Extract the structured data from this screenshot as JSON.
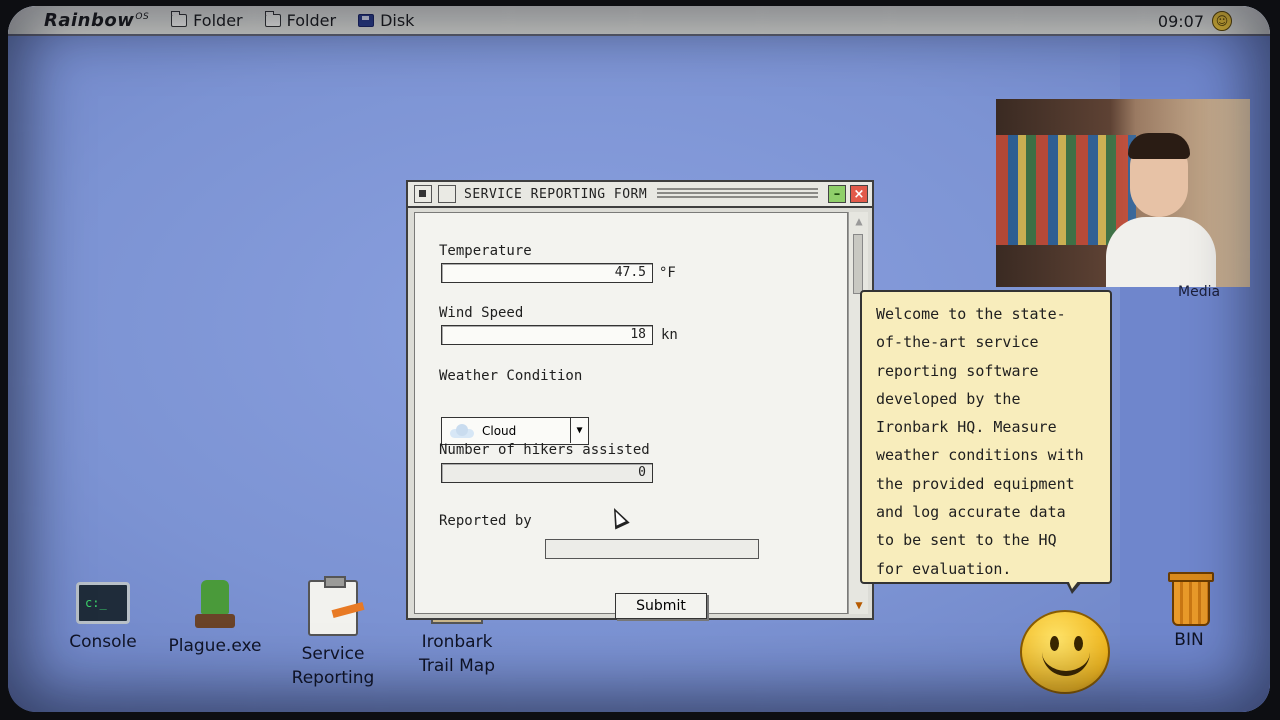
{
  "menubar": {
    "logo": "Rainbow",
    "logo_sup": "OS",
    "items": [
      {
        "label": "Folder",
        "icon": "folder-icon"
      },
      {
        "label": "Folder",
        "icon": "folder-icon"
      },
      {
        "label": "Disk",
        "icon": "disk-icon"
      }
    ],
    "clock": "09:07"
  },
  "window": {
    "title": "SERVICE REPORTING FORM",
    "temperature": {
      "label": "Temperature",
      "value": "47.5",
      "unit": "°F"
    },
    "wind_speed": {
      "label": "Wind Speed",
      "value": "18",
      "unit": "kn"
    },
    "weather": {
      "label": "Weather Condition",
      "value": "Cloud"
    },
    "hikers": {
      "label": "Number of hikers assisted",
      "value": "0"
    },
    "reported_by": {
      "label": "Reported by",
      "value": ""
    },
    "submit_label": "Submit"
  },
  "tooltip": {
    "lines": [
      "Welcome to the state-",
      "of-the-art service",
      "reporting software",
      "developed by the",
      "Ironbark HQ. Measure",
      "weather conditions with",
      "the provided equipment",
      "and log accurate data",
      "to be sent to the HQ",
      "for evaluation."
    ]
  },
  "webcam": {
    "label": "Media"
  },
  "desktop_icons": [
    {
      "id": "console",
      "line1": "Console",
      "line2": ""
    },
    {
      "id": "plague",
      "line1": "Plague.exe",
      "line2": ""
    },
    {
      "id": "service",
      "line1": "Service",
      "line2": "Reporting"
    },
    {
      "id": "trail",
      "line1": "Ironbark",
      "line2": "Trail Map"
    },
    {
      "id": "bin",
      "line1": "BIN",
      "line2": ""
    }
  ]
}
